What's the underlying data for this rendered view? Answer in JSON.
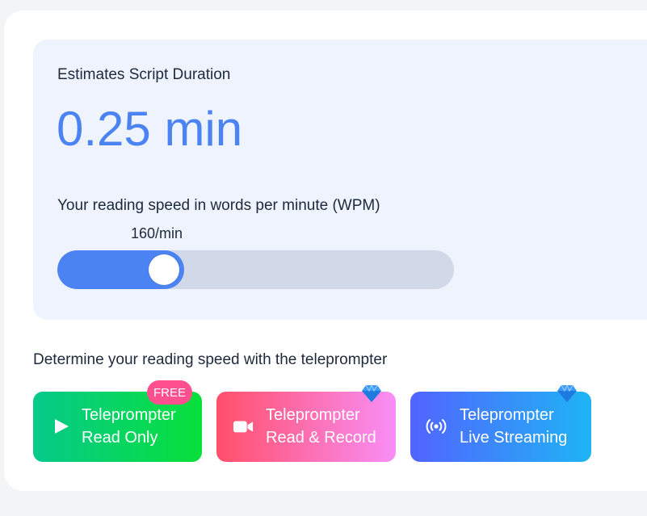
{
  "estimate": {
    "label": "Estimates Script Duration",
    "value": "0.25 min"
  },
  "reading_speed": {
    "label": "Your reading speed in words per minute (WPM)",
    "value_text": "160/min",
    "slider_fraction": 0.32
  },
  "teleprompter": {
    "prompt": "Determine your reading speed with the teleprompter",
    "buttons": [
      {
        "line1": "Teleprompter",
        "line2": "Read Only",
        "icon": "play-icon",
        "badge": "FREE"
      },
      {
        "line1": "Teleprompter",
        "line2": "Read & Record",
        "icon": "video-camera-icon",
        "badge_icon": "diamond-icon"
      },
      {
        "line1": "Teleprompter",
        "line2": "Live Streaming",
        "icon": "broadcast-icon",
        "badge_icon": "diamond-icon"
      }
    ]
  },
  "colors": {
    "accent": "#4b83f2",
    "panel_bg": "#eef3fd",
    "track": "#d1d9e8",
    "free_badge": "#ff4f8e",
    "gem": "#3b9bf5"
  }
}
